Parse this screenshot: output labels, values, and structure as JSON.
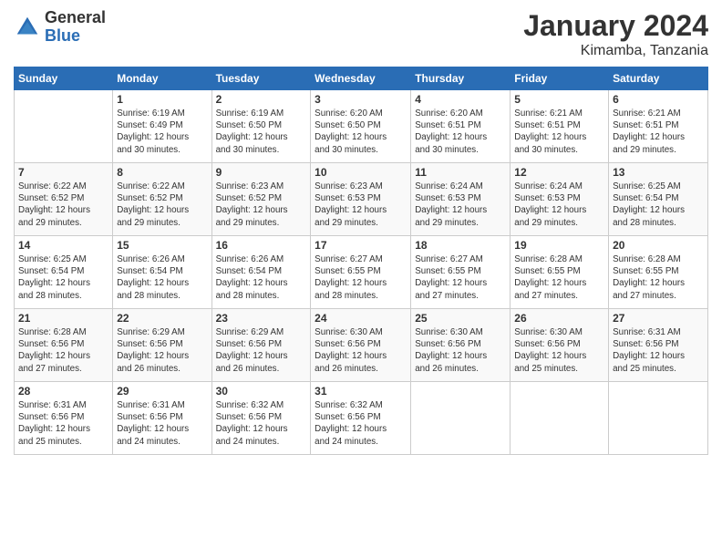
{
  "logo": {
    "general": "General",
    "blue": "Blue"
  },
  "title": "January 2024",
  "location": "Kimamba, Tanzania",
  "days_of_week": [
    "Sunday",
    "Monday",
    "Tuesday",
    "Wednesday",
    "Thursday",
    "Friday",
    "Saturday"
  ],
  "weeks": [
    [
      {
        "day": "",
        "info": ""
      },
      {
        "day": "1",
        "info": "Sunrise: 6:19 AM\nSunset: 6:49 PM\nDaylight: 12 hours\nand 30 minutes."
      },
      {
        "day": "2",
        "info": "Sunrise: 6:19 AM\nSunset: 6:50 PM\nDaylight: 12 hours\nand 30 minutes."
      },
      {
        "day": "3",
        "info": "Sunrise: 6:20 AM\nSunset: 6:50 PM\nDaylight: 12 hours\nand 30 minutes."
      },
      {
        "day": "4",
        "info": "Sunrise: 6:20 AM\nSunset: 6:51 PM\nDaylight: 12 hours\nand 30 minutes."
      },
      {
        "day": "5",
        "info": "Sunrise: 6:21 AM\nSunset: 6:51 PM\nDaylight: 12 hours\nand 30 minutes."
      },
      {
        "day": "6",
        "info": "Sunrise: 6:21 AM\nSunset: 6:51 PM\nDaylight: 12 hours\nand 29 minutes."
      }
    ],
    [
      {
        "day": "7",
        "info": "Sunrise: 6:22 AM\nSunset: 6:52 PM\nDaylight: 12 hours\nand 29 minutes."
      },
      {
        "day": "8",
        "info": "Sunrise: 6:22 AM\nSunset: 6:52 PM\nDaylight: 12 hours\nand 29 minutes."
      },
      {
        "day": "9",
        "info": "Sunrise: 6:23 AM\nSunset: 6:52 PM\nDaylight: 12 hours\nand 29 minutes."
      },
      {
        "day": "10",
        "info": "Sunrise: 6:23 AM\nSunset: 6:53 PM\nDaylight: 12 hours\nand 29 minutes."
      },
      {
        "day": "11",
        "info": "Sunrise: 6:24 AM\nSunset: 6:53 PM\nDaylight: 12 hours\nand 29 minutes."
      },
      {
        "day": "12",
        "info": "Sunrise: 6:24 AM\nSunset: 6:53 PM\nDaylight: 12 hours\nand 29 minutes."
      },
      {
        "day": "13",
        "info": "Sunrise: 6:25 AM\nSunset: 6:54 PM\nDaylight: 12 hours\nand 28 minutes."
      }
    ],
    [
      {
        "day": "14",
        "info": "Sunrise: 6:25 AM\nSunset: 6:54 PM\nDaylight: 12 hours\nand 28 minutes."
      },
      {
        "day": "15",
        "info": "Sunrise: 6:26 AM\nSunset: 6:54 PM\nDaylight: 12 hours\nand 28 minutes."
      },
      {
        "day": "16",
        "info": "Sunrise: 6:26 AM\nSunset: 6:54 PM\nDaylight: 12 hours\nand 28 minutes."
      },
      {
        "day": "17",
        "info": "Sunrise: 6:27 AM\nSunset: 6:55 PM\nDaylight: 12 hours\nand 28 minutes."
      },
      {
        "day": "18",
        "info": "Sunrise: 6:27 AM\nSunset: 6:55 PM\nDaylight: 12 hours\nand 27 minutes."
      },
      {
        "day": "19",
        "info": "Sunrise: 6:28 AM\nSunset: 6:55 PM\nDaylight: 12 hours\nand 27 minutes."
      },
      {
        "day": "20",
        "info": "Sunrise: 6:28 AM\nSunset: 6:55 PM\nDaylight: 12 hours\nand 27 minutes."
      }
    ],
    [
      {
        "day": "21",
        "info": "Sunrise: 6:28 AM\nSunset: 6:56 PM\nDaylight: 12 hours\nand 27 minutes."
      },
      {
        "day": "22",
        "info": "Sunrise: 6:29 AM\nSunset: 6:56 PM\nDaylight: 12 hours\nand 26 minutes."
      },
      {
        "day": "23",
        "info": "Sunrise: 6:29 AM\nSunset: 6:56 PM\nDaylight: 12 hours\nand 26 minutes."
      },
      {
        "day": "24",
        "info": "Sunrise: 6:30 AM\nSunset: 6:56 PM\nDaylight: 12 hours\nand 26 minutes."
      },
      {
        "day": "25",
        "info": "Sunrise: 6:30 AM\nSunset: 6:56 PM\nDaylight: 12 hours\nand 26 minutes."
      },
      {
        "day": "26",
        "info": "Sunrise: 6:30 AM\nSunset: 6:56 PM\nDaylight: 12 hours\nand 25 minutes."
      },
      {
        "day": "27",
        "info": "Sunrise: 6:31 AM\nSunset: 6:56 PM\nDaylight: 12 hours\nand 25 minutes."
      }
    ],
    [
      {
        "day": "28",
        "info": "Sunrise: 6:31 AM\nSunset: 6:56 PM\nDaylight: 12 hours\nand 25 minutes."
      },
      {
        "day": "29",
        "info": "Sunrise: 6:31 AM\nSunset: 6:56 PM\nDaylight: 12 hours\nand 24 minutes."
      },
      {
        "day": "30",
        "info": "Sunrise: 6:32 AM\nSunset: 6:56 PM\nDaylight: 12 hours\nand 24 minutes."
      },
      {
        "day": "31",
        "info": "Sunrise: 6:32 AM\nSunset: 6:56 PM\nDaylight: 12 hours\nand 24 minutes."
      },
      {
        "day": "",
        "info": ""
      },
      {
        "day": "",
        "info": ""
      },
      {
        "day": "",
        "info": ""
      }
    ]
  ]
}
